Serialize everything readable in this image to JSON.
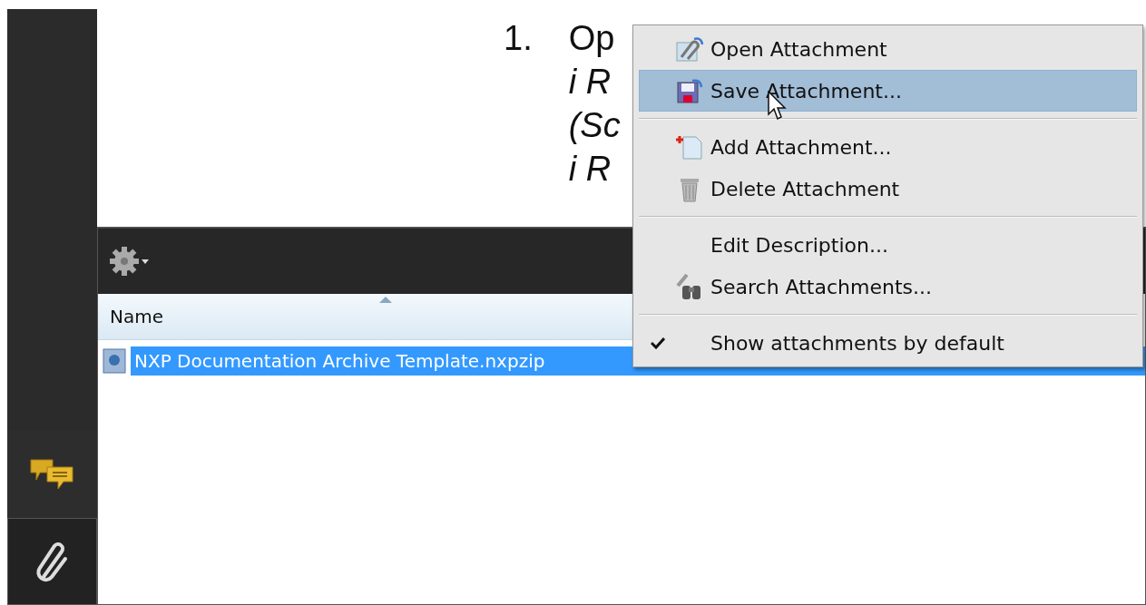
{
  "document": {
    "number": "1.",
    "lines": [
      {
        "text": "Op",
        "italic": false
      },
      {
        "text": "i R",
        "italic": true
      },
      {
        "text": "(Sc",
        "italic": true
      },
      {
        "text": "i R",
        "italic": true
      }
    ]
  },
  "sidebar": {
    "items": [
      {
        "selected": false
      },
      {
        "selected": true
      }
    ]
  },
  "attachments": {
    "columns": [
      "Name"
    ],
    "rows": [
      {
        "name": "NXP Documentation Archive Template.nxpzip",
        "selected": true
      }
    ]
  },
  "context_menu": {
    "items": [
      {
        "kind": "open",
        "label": "Open Attachment",
        "selected": false
      },
      {
        "kind": "save",
        "label": "Save Attachment...",
        "selected": true
      },
      {
        "kind": "separator"
      },
      {
        "kind": "add",
        "label": "Add Attachment...",
        "selected": false
      },
      {
        "kind": "delete",
        "label": "Delete Attachment",
        "selected": false
      },
      {
        "kind": "separator"
      },
      {
        "kind": "plain",
        "label": "Edit Description...",
        "selected": false
      },
      {
        "kind": "search",
        "label": "Search Attachments...",
        "selected": false
      },
      {
        "kind": "separator"
      },
      {
        "kind": "check",
        "label": "Show attachments by default",
        "checked": true,
        "selected": false
      }
    ]
  }
}
